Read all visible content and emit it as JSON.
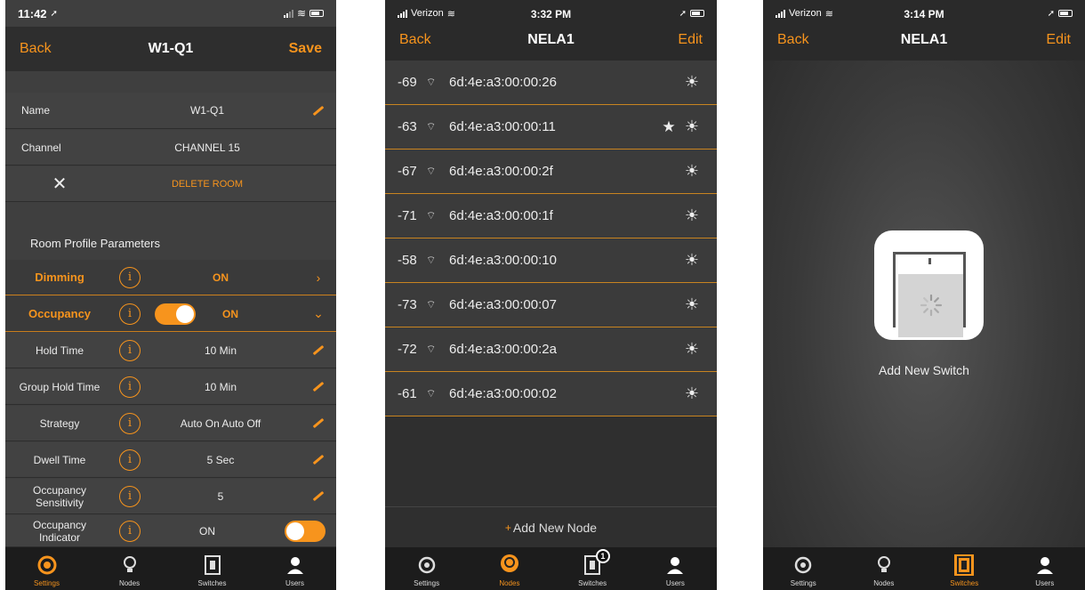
{
  "phone1": {
    "status": {
      "time": "11:42"
    },
    "nav": {
      "back": "Back",
      "title": "W1-Q1",
      "save": "Save"
    },
    "fields": {
      "name_label": "Name",
      "name_value": "W1-Q1",
      "channel_label": "Channel",
      "channel_value": "CHANNEL 15",
      "delete_label": "DELETE ROOM"
    },
    "section_title": "Room Profile Parameters",
    "params": {
      "dimming_label": "Dimming",
      "dimming_value": "ON",
      "occupancy_label": "Occupancy",
      "occupancy_value": "ON",
      "hold_label": "Hold Time",
      "hold_value": "10 Min",
      "group_hold_label": "Group Hold Time",
      "group_hold_value": "10 Min",
      "strategy_label": "Strategy",
      "strategy_value": "Auto On Auto Off",
      "dwell_label": "Dwell Time",
      "dwell_value": "5 Sec",
      "sens_label_1": "Occupancy",
      "sens_label_2": "Sensitivity",
      "sens_value": "5",
      "indicator_label_1": "Occupancy",
      "indicator_label_2": "Indicator",
      "indicator_value": "ON"
    },
    "info_glyph": "i",
    "tabs": {
      "settings": "Settings",
      "nodes": "Nodes",
      "switches": "Switches",
      "users": "Users"
    }
  },
  "phone2": {
    "status": {
      "carrier": "Verizon",
      "time": "3:32 PM"
    },
    "nav": {
      "back": "Back",
      "title": "NELA1",
      "edit": "Edit"
    },
    "nodes": [
      {
        "rssi": "-69",
        "mac": "6d:4e:a3:00:00:26",
        "star": ""
      },
      {
        "rssi": "-63",
        "mac": "6d:4e:a3:00:00:11",
        "star": "★"
      },
      {
        "rssi": "-67",
        "mac": "6d:4e:a3:00:00:2f",
        "star": ""
      },
      {
        "rssi": "-71",
        "mac": "6d:4e:a3:00:00:1f",
        "star": ""
      },
      {
        "rssi": "-58",
        "mac": "6d:4e:a3:00:00:10",
        "star": ""
      },
      {
        "rssi": "-73",
        "mac": "6d:4e:a3:00:00:07",
        "star": ""
      },
      {
        "rssi": "-72",
        "mac": "6d:4e:a3:00:00:2a",
        "star": ""
      },
      {
        "rssi": "-61",
        "mac": "6d:4e:a3:00:00:02",
        "star": ""
      }
    ],
    "add_node": "Add New Node",
    "switches_badge": "1",
    "tabs": {
      "settings": "Settings",
      "nodes": "Nodes",
      "switches": "Switches",
      "users": "Users"
    }
  },
  "phone3": {
    "status": {
      "carrier": "Verizon",
      "time": "3:14 PM"
    },
    "nav": {
      "back": "Back",
      "title": "NELA1",
      "edit": "Edit"
    },
    "add_switch": "Add New Switch",
    "tabs": {
      "settings": "Settings",
      "nodes": "Nodes",
      "switches": "Switches",
      "users": "Users"
    }
  },
  "icons": {
    "wifi": "wifi-icon",
    "sun": "light-sun-icon",
    "star": "star-icon",
    "gear": "gear-icon",
    "bulb": "bulb-icon",
    "switch": "switch-icon",
    "user": "user-icon"
  },
  "colors": {
    "accent": "#f7941d",
    "tabbar": "#1c1c1c",
    "row_separator": "#c88420"
  }
}
